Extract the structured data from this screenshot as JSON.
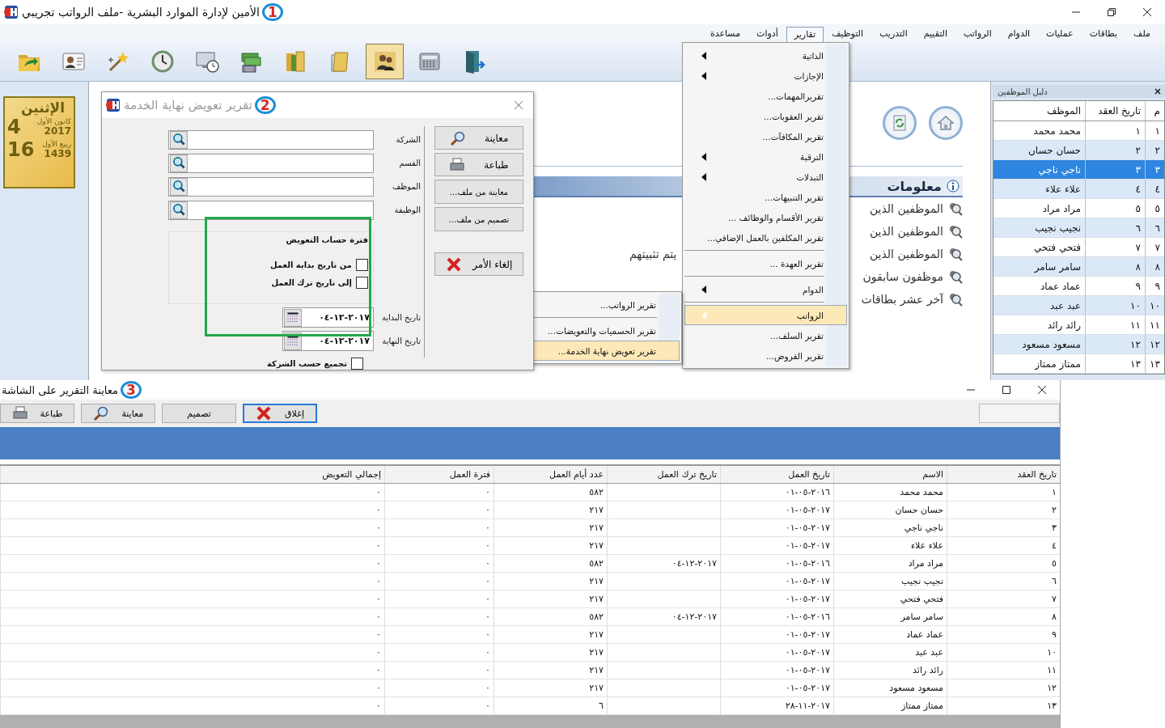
{
  "app": {
    "title": "الأمين لإدارة الموارد البشرية -ملف الرواتب تجريبي",
    "badge": "1"
  },
  "menubar": [
    {
      "label": "ملف",
      "selected": false
    },
    {
      "label": "بطاقات",
      "selected": false
    },
    {
      "label": "عمليات",
      "selected": false
    },
    {
      "label": "الدوام",
      "selected": false
    },
    {
      "label": "الرواتب",
      "selected": false
    },
    {
      "label": "التقييم",
      "selected": false
    },
    {
      "label": "التدريب",
      "selected": false
    },
    {
      "label": "التوظيف",
      "selected": false
    },
    {
      "label": "تقارير",
      "selected": true
    },
    {
      "label": "أدوات",
      "selected": false
    },
    {
      "label": "مساعدة",
      "selected": false
    }
  ],
  "toolbar": [
    {
      "kind": "folder-arrow",
      "selected": false
    },
    {
      "kind": "id-card",
      "selected": false
    },
    {
      "kind": "wand",
      "selected": false
    },
    {
      "kind": "clock",
      "selected": false
    },
    {
      "kind": "monitor-clock",
      "selected": false
    },
    {
      "kind": "cash",
      "selected": false
    },
    {
      "kind": "books",
      "selected": false
    },
    {
      "kind": "folders",
      "selected": false
    },
    {
      "kind": "people",
      "selected": true
    },
    {
      "kind": "calculator",
      "selected": false
    },
    {
      "kind": "door",
      "selected": false
    }
  ],
  "calendar": {
    "weekday": "الإثنين",
    "gregorian_month": "كانون الأول",
    "gregorian_day": "4",
    "gregorian_year": "2017",
    "hijri_month": "ربيع الأول",
    "hijri_day": "16",
    "hijri_year": "1439"
  },
  "home": {
    "buttons": [
      {
        "kind": "home"
      },
      {
        "kind": "refresh"
      }
    ],
    "header": "معلومات",
    "items": [
      {
        "text": "الموظفين الذين"
      },
      {
        "text": "الموظفين الذين"
      },
      {
        "text": "الموظفين الذين",
        "tail": "يتم تثبيتهم"
      },
      {
        "text": "موظفون سابقون"
      },
      {
        "text": "آخر عشر بطاقات"
      }
    ]
  },
  "employee_panel": {
    "title": "دليل الموظفين",
    "columns": [
      "م",
      "تاريخ العقد",
      "الموظف"
    ],
    "rows": [
      {
        "cells": [
          "١",
          "١",
          "محمد محمد"
        ],
        "selected": false
      },
      {
        "cells": [
          "٢",
          "٢",
          "حسان حسان"
        ],
        "selected": false
      },
      {
        "cells": [
          "٣",
          "٣",
          "ناجي ناجي"
        ],
        "selected": true
      },
      {
        "cells": [
          "٤",
          "٤",
          "علاء علاء"
        ],
        "selected": false
      },
      {
        "cells": [
          "٥",
          "٥",
          "مراد مراد"
        ],
        "selected": false
      },
      {
        "cells": [
          "٦",
          "٦",
          "نجيب نجيب"
        ],
        "selected": false
      },
      {
        "cells": [
          "٧",
          "٧",
          "فتحي فتحي"
        ],
        "selected": false
      },
      {
        "cells": [
          "٨",
          "٨",
          "سامر سامر"
        ],
        "selected": false
      },
      {
        "cells": [
          "٩",
          "٩",
          "عماد عماد"
        ],
        "selected": false
      },
      {
        "cells": [
          "١٠",
          "١٠",
          "عبد عبد"
        ],
        "selected": false
      },
      {
        "cells": [
          "١١",
          "١١",
          "رائد رائد"
        ],
        "selected": false
      },
      {
        "cells": [
          "١٢",
          "١٢",
          "مسعود مسعود"
        ],
        "selected": false
      },
      {
        "cells": [
          "١٣",
          "١٣",
          "ممتاز ممتاز"
        ],
        "selected": false
      }
    ]
  },
  "reports_menu": [
    {
      "kind": "item",
      "label": "الذاتية",
      "submenu": true,
      "selected": false
    },
    {
      "kind": "item",
      "label": "الإجازات",
      "submenu": true,
      "selected": false
    },
    {
      "kind": "item",
      "label": "تقريرالمهمات...",
      "submenu": false,
      "selected": false
    },
    {
      "kind": "item",
      "label": "تقرير العقوبات...",
      "submenu": false,
      "selected": false
    },
    {
      "kind": "item",
      "label": "تقرير المكافآت...",
      "submenu": false,
      "selected": false
    },
    {
      "kind": "item",
      "label": "الترقية",
      "submenu": true,
      "selected": false
    },
    {
      "kind": "item",
      "label": "التبدلات",
      "submenu": true,
      "selected": false
    },
    {
      "kind": "item",
      "label": "تقرير التنبيهات...",
      "submenu": false,
      "selected": false
    },
    {
      "kind": "item",
      "label": "تقرير الأقسام والوظائف ...",
      "submenu": false,
      "selected": false
    },
    {
      "kind": "item",
      "label": "تقرير المكلفين بالعمل الإضافي...",
      "submenu": false,
      "selected": false
    },
    {
      "kind": "separator"
    },
    {
      "kind": "item",
      "label": "تقرير العهدة ...",
      "submenu": false,
      "selected": false
    },
    {
      "kind": "separator"
    },
    {
      "kind": "item",
      "label": "الدوام",
      "submenu": true,
      "selected": false
    },
    {
      "kind": "separator"
    },
    {
      "kind": "item",
      "label": "الرواتب",
      "submenu": true,
      "selected": true
    },
    {
      "kind": "item",
      "label": "تقرير السلف...",
      "submenu": false,
      "selected": false
    },
    {
      "kind": "item",
      "label": "تقرير القروض...",
      "submenu": false,
      "selected": false
    }
  ],
  "salaries_submenu": [
    {
      "kind": "item",
      "label": "تقرير الرواتب...",
      "selected": false
    },
    {
      "kind": "separator"
    },
    {
      "kind": "item",
      "label": "تقرير الحسميات والتعويضات...",
      "selected": false
    },
    {
      "kind": "item",
      "label": "تقرير تعويض نهاية الخدمة...",
      "selected": true
    }
  ],
  "dialog": {
    "title": "تقرير تعويض نهاية الخدمة",
    "badge": "2",
    "fields": [
      {
        "label": "الشركة"
      },
      {
        "label": "القسم"
      },
      {
        "label": "الموظف"
      },
      {
        "label": "الوظيفة"
      }
    ],
    "period": {
      "caption": "فترة حساب التعويض",
      "highlighted": true,
      "options": [
        {
          "label": "من تاريخ بداية العمل",
          "checked": false
        },
        {
          "label": "إلى تاريخ ترك العمل",
          "checked": false
        }
      ],
      "dates": [
        {
          "label": "تاريخ البداية",
          "value": "٠٤-١٢-٢٠١٧"
        },
        {
          "label": "تاريخ النهاية",
          "value": "٠٤-١٢-٢٠١٧"
        }
      ]
    },
    "group_by_company": {
      "label": "تجميع حسب الشركة",
      "checked": false
    },
    "buttons": [
      {
        "kind": "preview",
        "label": "معاينة"
      },
      {
        "kind": "print",
        "label": "طباعة"
      },
      {
        "kind": "file",
        "label": "معاينة من ملف..."
      },
      {
        "kind": "file",
        "label": "تصميم من ملف..."
      },
      {
        "kind": "cancel",
        "label": "إلغاء الأمر"
      }
    ]
  },
  "report_window": {
    "title": "معاينة التقرير على الشاشة",
    "badge": "3",
    "buttons": [
      {
        "kind": "close",
        "label": "إغلاق",
        "focused": true
      },
      {
        "kind": "design",
        "label": "تصميم",
        "focused": false
      },
      {
        "kind": "preview",
        "label": "معاينة",
        "focused": false
      },
      {
        "kind": "print",
        "label": "طباعة",
        "focused": false
      }
    ],
    "columns": [
      "تاريخ العقد",
      "الاسم",
      "تاريخ العمل",
      "تاريخ ترك العمل",
      "عدد أيام العمل",
      "فترة العمل",
      "إجمالي التعويض"
    ],
    "rows": [
      [
        "١",
        "محمد محمد",
        "٠١-٠٥-٢٠١٦",
        "",
        "٥٨٢",
        "٠",
        "٠"
      ],
      [
        "٢",
        "حسان حسان",
        "٠١-٠٥-٢٠١٧",
        "",
        "٢١٧",
        "٠",
        "٠"
      ],
      [
        "٣",
        "ناجي ناجي",
        "٠١-٠٥-٢٠١٧",
        "",
        "٢١٧",
        "٠",
        "٠"
      ],
      [
        "٤",
        "علاء علاء",
        "٠١-٠٥-٢٠١٧",
        "",
        "٢١٧",
        "٠",
        "٠"
      ],
      [
        "٥",
        "مراد مراد",
        "٠١-٠٥-٢٠١٦",
        "٠٤-١٢-٢٠١٧",
        "٥٨٢",
        "٠",
        "٠"
      ],
      [
        "٦",
        "نجيب نجيب",
        "٠١-٠٥-٢٠١٧",
        "",
        "٢١٧",
        "٠",
        "٠"
      ],
      [
        "٧",
        "فتحي فتحي",
        "٠١-٠٥-٢٠١٧",
        "",
        "٢١٧",
        "٠",
        "٠"
      ],
      [
        "٨",
        "سامر سامر",
        "٠١-٠٥-٢٠١٦",
        "٠٤-١٢-٢٠١٧",
        "٥٨٢",
        "٠",
        "٠"
      ],
      [
        "٩",
        "عماد عماد",
        "٠١-٠٥-٢٠١٧",
        "",
        "٢١٧",
        "٠",
        "٠"
      ],
      [
        "١٠",
        "عبد عبد",
        "٠١-٠٥-٢٠١٧",
        "",
        "٢١٧",
        "٠",
        "٠"
      ],
      [
        "١١",
        "رائد رائد",
        "٠١-٠٥-٢٠١٧",
        "",
        "٢١٧",
        "٠",
        "٠"
      ],
      [
        "١٢",
        "مسعود مسعود",
        "٠١-٠٥-٢٠١٧",
        "",
        "٢١٧",
        "٠",
        "٠"
      ],
      [
        "١٣",
        "ممتاز ممتاز",
        "٢٨-١١-٢٠١٧",
        "",
        "٦",
        "٠",
        "٠"
      ]
    ]
  }
}
